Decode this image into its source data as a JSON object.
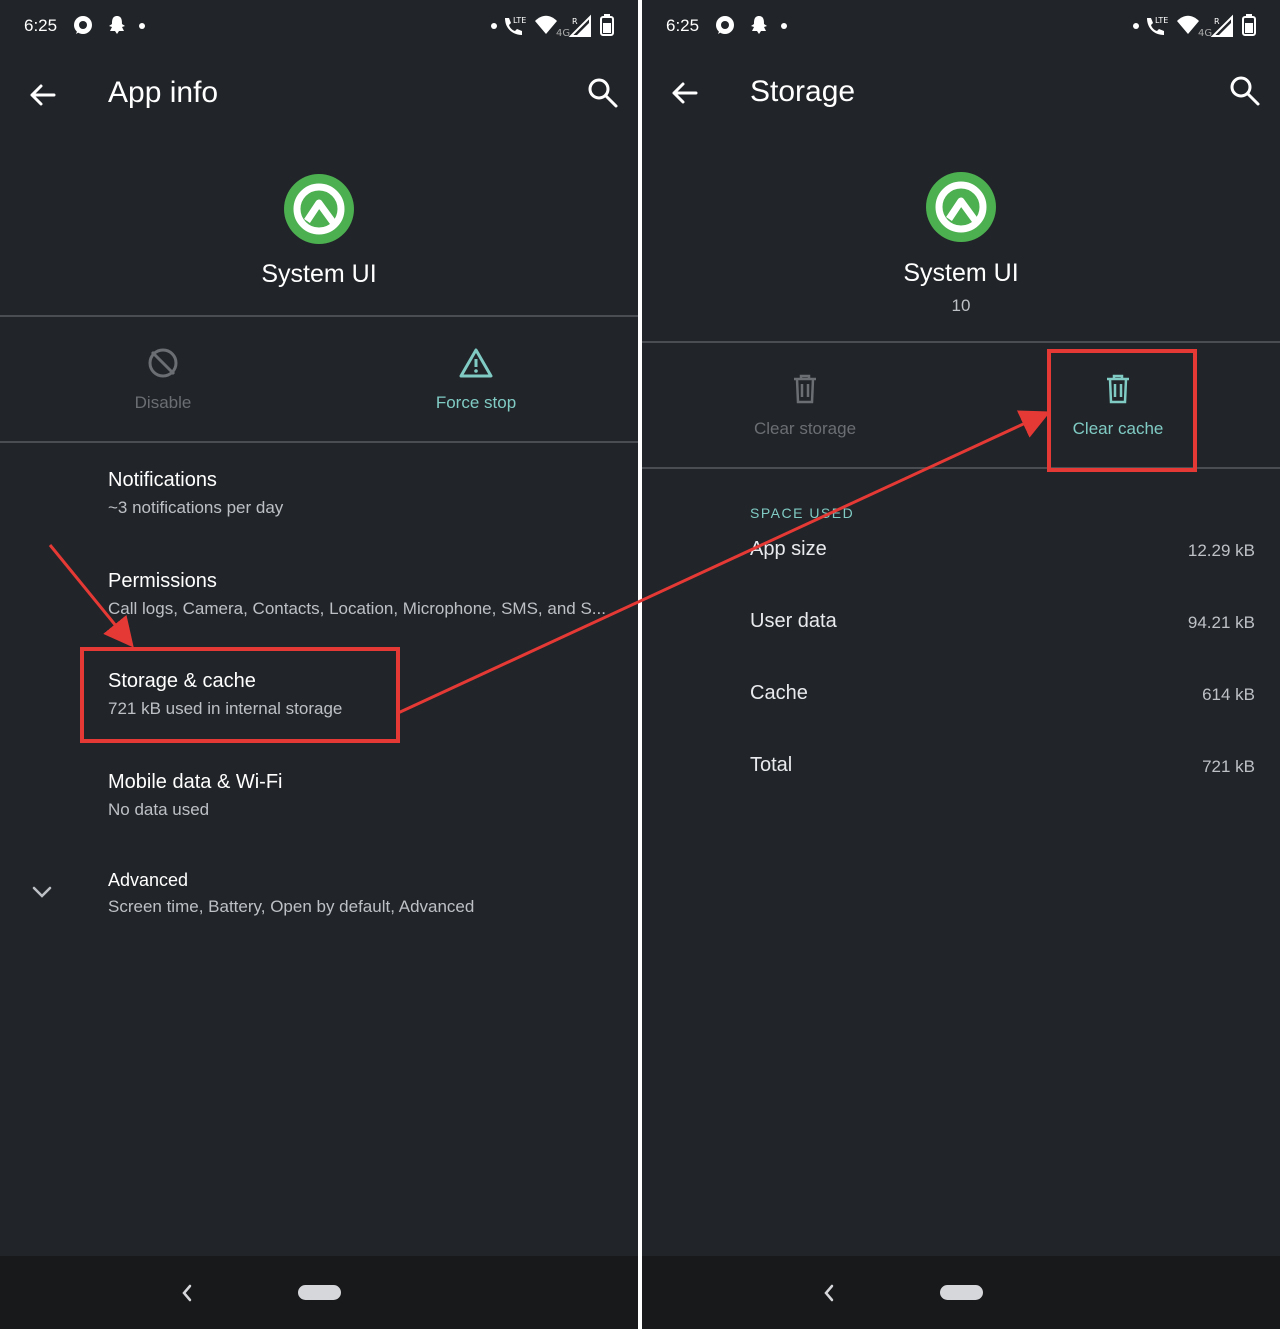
{
  "left": {
    "status": {
      "time": "6:25"
    },
    "toolbar": {
      "title": "App info"
    },
    "app": {
      "name": "System UI"
    },
    "actions": [
      {
        "label": "Disable",
        "enabled": false
      },
      {
        "label": "Force stop",
        "enabled": true
      }
    ],
    "items": [
      {
        "title": "Notifications",
        "subtitle": "~3 notifications per day"
      },
      {
        "title": "Permissions",
        "subtitle": "Call logs, Camera, Contacts, Location, Microphone, SMS, and S..."
      },
      {
        "title": "Storage & cache",
        "subtitle": "721 kB used in internal storage"
      },
      {
        "title": "Mobile data & Wi-Fi",
        "subtitle": "No data used"
      },
      {
        "title": "Advanced",
        "subtitle": "Screen time, Battery, Open by default, Advanced"
      }
    ]
  },
  "right": {
    "status": {
      "time": "6:25"
    },
    "toolbar": {
      "title": "Storage"
    },
    "app": {
      "name": "System UI",
      "version": "10"
    },
    "actions": [
      {
        "label": "Clear storage",
        "enabled": false
      },
      {
        "label": "Clear cache",
        "enabled": true
      }
    ],
    "space": {
      "header": "SPACE USED",
      "rows": [
        {
          "label": "App size",
          "value": "12.29 kB"
        },
        {
          "label": "User data",
          "value": "94.21 kB"
        },
        {
          "label": "Cache",
          "value": "614 kB"
        },
        {
          "label": "Total",
          "value": "721 kB"
        }
      ]
    }
  },
  "theme": {
    "background": "#212428",
    "accent": "#80cbc4",
    "icon_green": "#4caf50",
    "annotation_red": "#e53935"
  }
}
